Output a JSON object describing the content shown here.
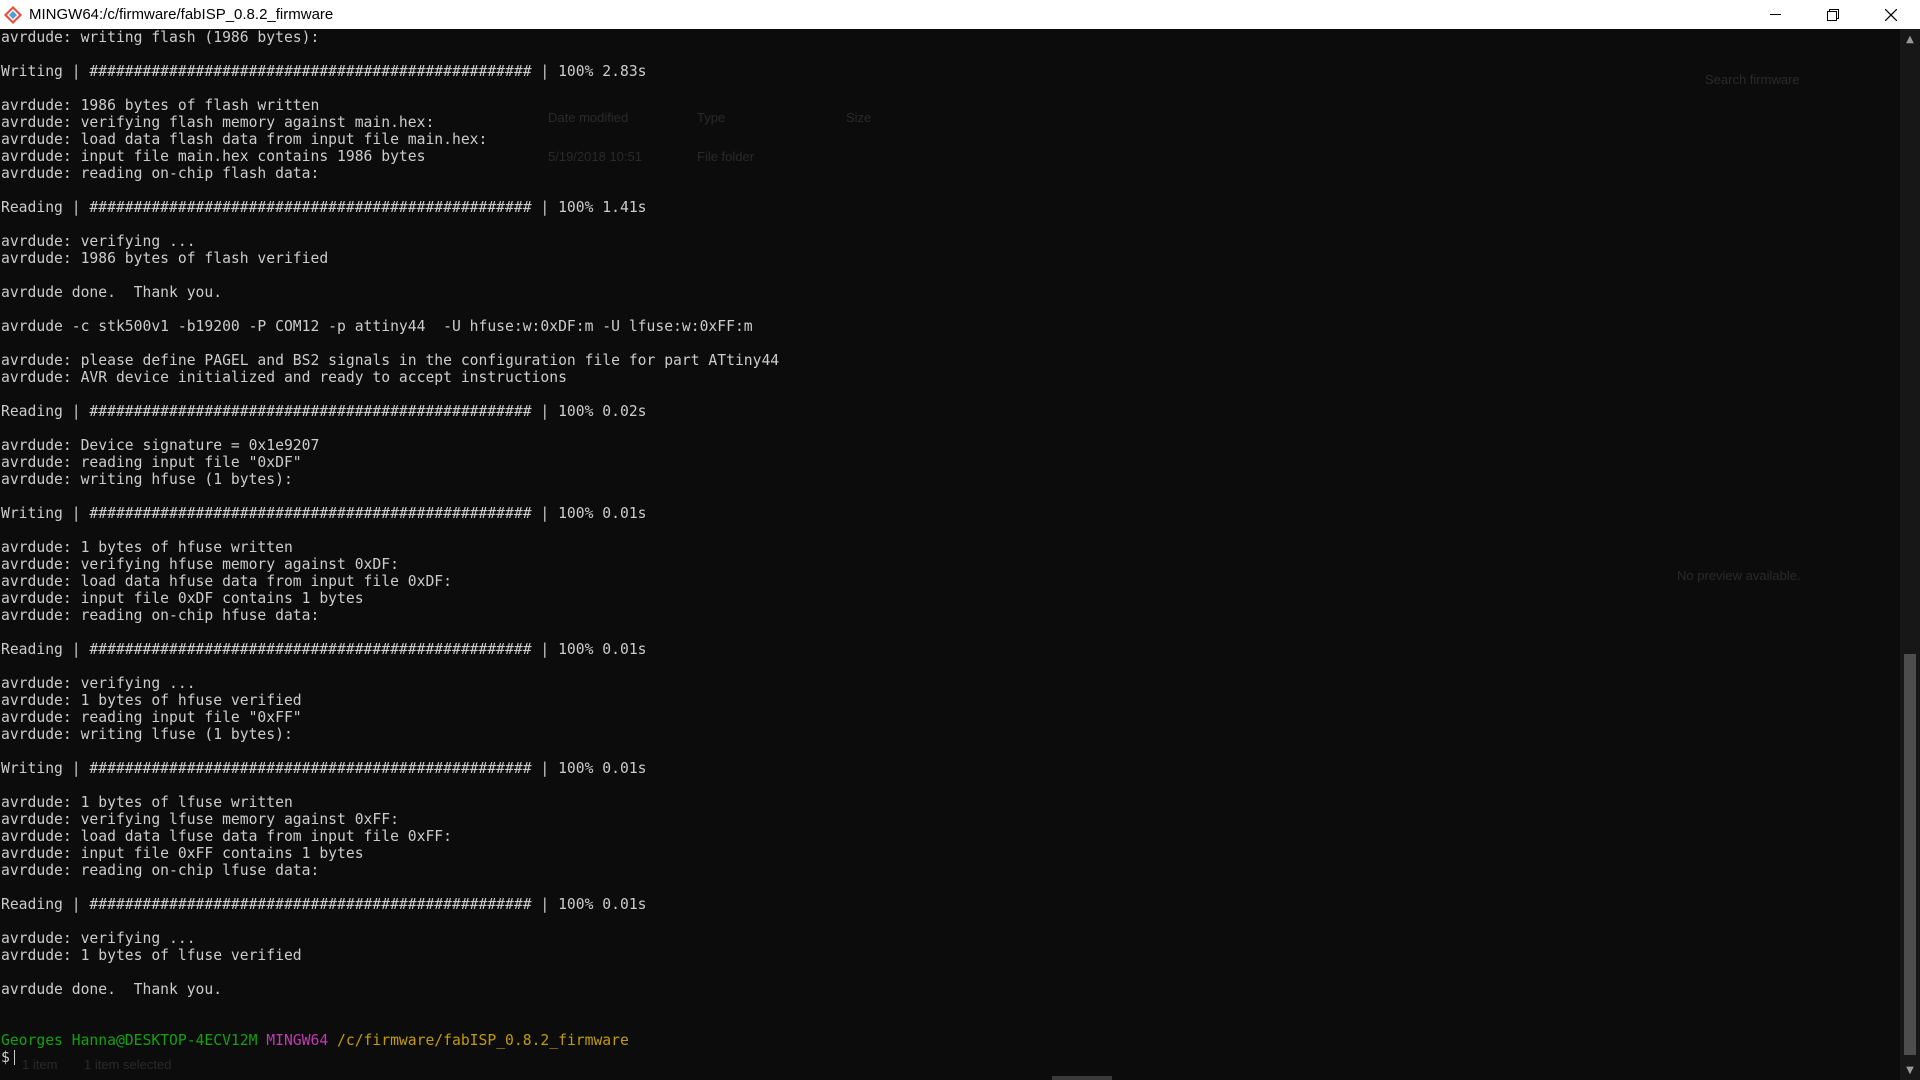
{
  "window": {
    "title": "MINGW64:/c/firmware/fabISP_0.8.2_firmware",
    "app_icon": "mingw-diamond-icon",
    "controls": {
      "minimize_icon": "minimize-icon",
      "restore_icon": "restore-icon",
      "close_icon": "close-icon"
    }
  },
  "terminal": {
    "lines": [
      "avrdude: writing flash (1986 bytes):",
      "",
      "Writing | ################################################## | 100% 2.83s",
      "",
      "avrdude: 1986 bytes of flash written",
      "avrdude: verifying flash memory against main.hex:",
      "avrdude: load data flash data from input file main.hex:",
      "avrdude: input file main.hex contains 1986 bytes",
      "avrdude: reading on-chip flash data:",
      "",
      "Reading | ################################################## | 100% 1.41s",
      "",
      "avrdude: verifying ...",
      "avrdude: 1986 bytes of flash verified",
      "",
      "avrdude done.  Thank you.",
      "",
      "avrdude -c stk500v1 -b19200 -P COM12 -p attiny44  -U hfuse:w:0xDF:m -U lfuse:w:0xFF:m",
      "",
      "avrdude: please define PAGEL and BS2 signals in the configuration file for part ATtiny44",
      "avrdude: AVR device initialized and ready to accept instructions",
      "",
      "Reading | ################################################## | 100% 0.02s",
      "",
      "avrdude: Device signature = 0x1e9207",
      "avrdude: reading input file \"0xDF\"",
      "avrdude: writing hfuse (1 bytes):",
      "",
      "Writing | ################################################## | 100% 0.01s",
      "",
      "avrdude: 1 bytes of hfuse written",
      "avrdude: verifying hfuse memory against 0xDF:",
      "avrdude: load data hfuse data from input file 0xDF:",
      "avrdude: input file 0xDF contains 1 bytes",
      "avrdude: reading on-chip hfuse data:",
      "",
      "Reading | ################################################## | 100% 0.01s",
      "",
      "avrdude: verifying ...",
      "avrdude: 1 bytes of hfuse verified",
      "avrdude: reading input file \"0xFF\"",
      "avrdude: writing lfuse (1 bytes):",
      "",
      "Writing | ################################################## | 100% 0.01s",
      "",
      "avrdude: 1 bytes of lfuse written",
      "avrdude: verifying lfuse memory against 0xFF:",
      "avrdude: load data lfuse data from input file 0xFF:",
      "avrdude: input file 0xFF contains 1 bytes",
      "avrdude: reading on-chip lfuse data:",
      "",
      "Reading | ################################################## | 100% 0.01s",
      "",
      "avrdude: verifying ...",
      "avrdude: 1 bytes of lfuse verified",
      "",
      "avrdude done.  Thank you.",
      "",
      ""
    ],
    "prompt": {
      "user": "Georges Hanna@DESKTOP-4ECV12M",
      "system": "MINGW64",
      "path": "/c/firmware/fabISP_0.8.2_firmware",
      "symbol": "$"
    },
    "colors": {
      "background": "#0c0c0c",
      "text": "#cccccc",
      "user": "#13a10e",
      "system": "#c239b3",
      "path": "#c19c00"
    }
  },
  "background_explorer": {
    "search_placeholder": "Search firmware",
    "col_date": "Date modified",
    "col_type": "Type",
    "col_size": "Size",
    "row_date": "5/19/2018 10:51",
    "row_type": "File folder",
    "no_preview": "No preview available.",
    "status_count": "1 item",
    "status_selected": "1 item selected"
  }
}
